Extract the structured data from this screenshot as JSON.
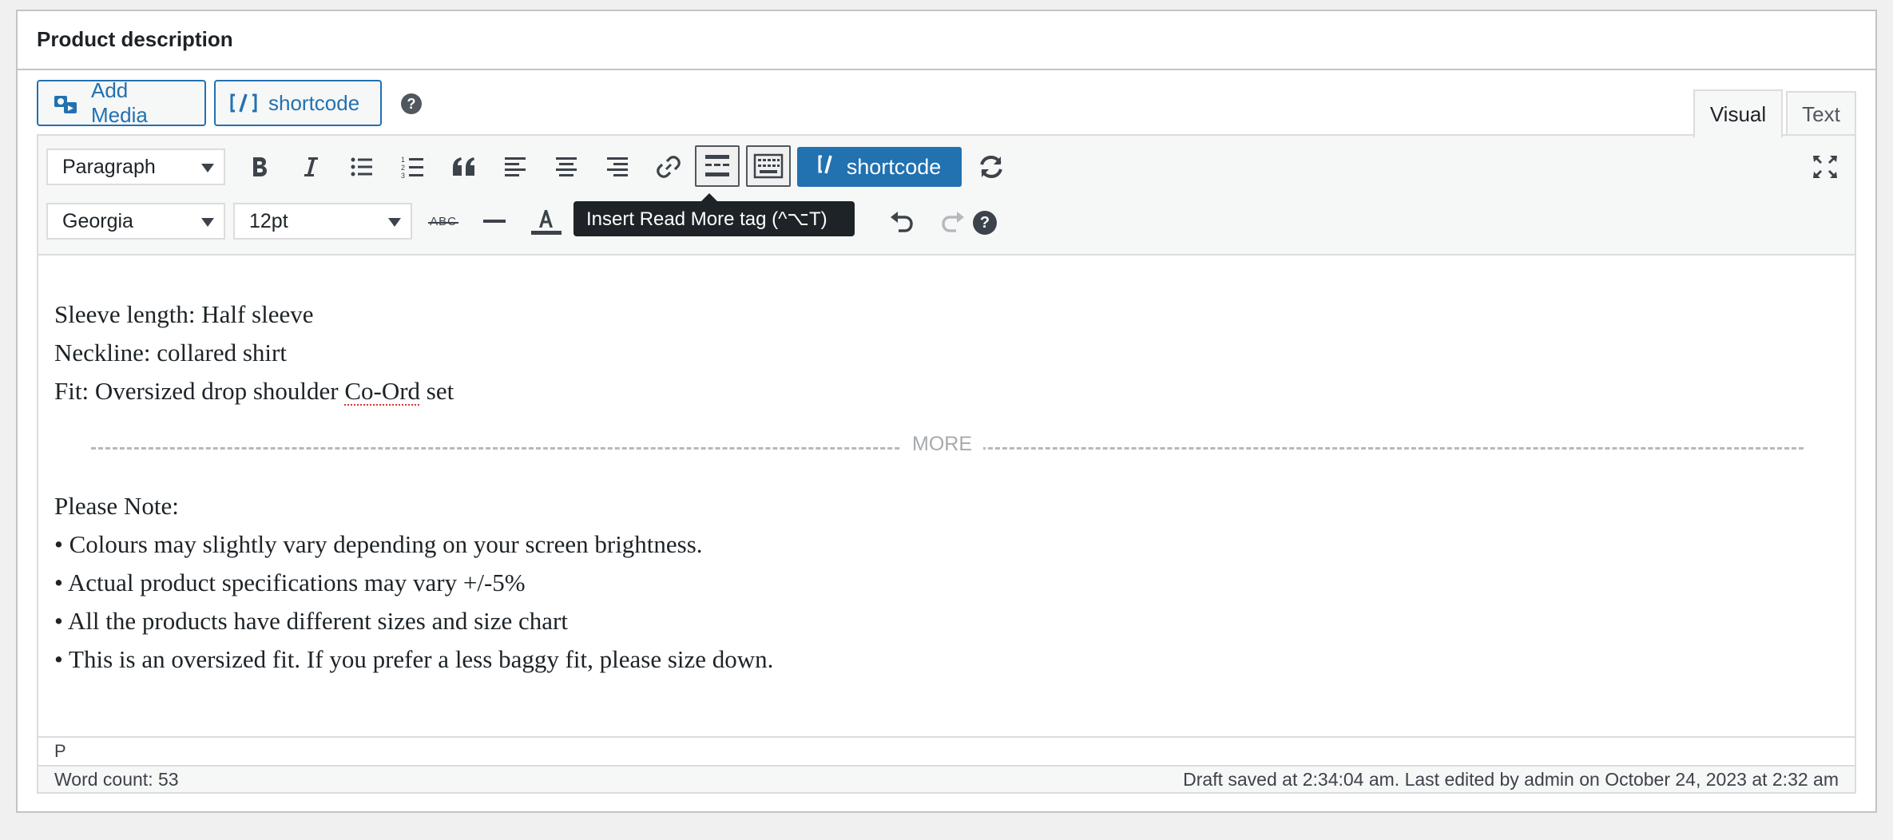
{
  "metabox": {
    "title": "Product description"
  },
  "media_buttons": {
    "add_media": "Add Media",
    "shortcode": "shortcode",
    "help": "?"
  },
  "tabs": {
    "visual": "Visual",
    "text": "Text",
    "active": "Visual"
  },
  "toolbar": {
    "format_select": "Paragraph",
    "font_family_select": "Georgia",
    "font_size_select": "12pt",
    "shortcode_button": "shortcode",
    "strikethrough_label": "ABC",
    "help": "?",
    "accent_color": "#2271b1"
  },
  "tooltip": {
    "text": "Insert Read More tag (^⌥T)"
  },
  "content": {
    "lines_top": [
      "Sleeve length: Half sleeve",
      "Neckline: collared shirt"
    ],
    "fit_prefix": "Fit: Oversized drop shoulder ",
    "fit_misspelled": "Co-Ord",
    "fit_suffix": " set",
    "more_label": "MORE",
    "lines_bottom": [
      "Please Note:",
      "• Colours may slightly vary depending on your screen brightness.",
      "• Actual product specifications may vary +/-5%",
      "• All the products have different sizes and size chart",
      "• This is an oversized fit. If you prefer a less baggy fit, please size down."
    ]
  },
  "path": "P",
  "status": {
    "word_count": "Word count: 53",
    "draft_info": "Draft saved at 2:34:04 am. Last edited by admin on October 24, 2023 at 2:32 am"
  }
}
